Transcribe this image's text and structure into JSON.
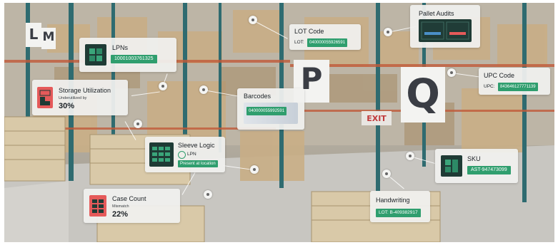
{
  "colors": {
    "accent_green": "#2f9e6e",
    "dark_teal": "#1f3b35",
    "alert_red": "#e55a5a",
    "card_bg": "#f0f0ee"
  },
  "signs": {
    "p": "P",
    "q": "Q",
    "l": "L",
    "m": "M",
    "exit": "EXIT"
  },
  "callouts": {
    "lpns": {
      "title": "LPNs",
      "value": "10001003761325",
      "icon": "grid-icon"
    },
    "lot_code": {
      "title": "LOT Code",
      "key": "LOT:",
      "value": "040000055926591"
    },
    "pallet_audits": {
      "title": "Pallet Audits",
      "icon": "pallet-icon"
    },
    "storage": {
      "title": "Storage Utilization",
      "sub": "Underutilized by",
      "value": "30%",
      "icon": "storage-icon"
    },
    "barcodes": {
      "title": "Barcodes",
      "value": "040000055992591"
    },
    "upc": {
      "title": "UPC Code",
      "key": "UPC:",
      "value": "843646127771139"
    },
    "sleeve": {
      "title": "Sleeve Logic",
      "check_label": "LPN",
      "value": "Present at location",
      "icon": "sleeve-icon"
    },
    "sku": {
      "title": "SKU",
      "value": "AST-947473099",
      "icon": "sku-icon"
    },
    "case_count": {
      "title": "Case Count",
      "sub": "Mismatch",
      "value": "22%",
      "icon": "case-icon"
    },
    "handwriting": {
      "title": "Handwriting",
      "value": "LOT: B-409382917"
    }
  }
}
